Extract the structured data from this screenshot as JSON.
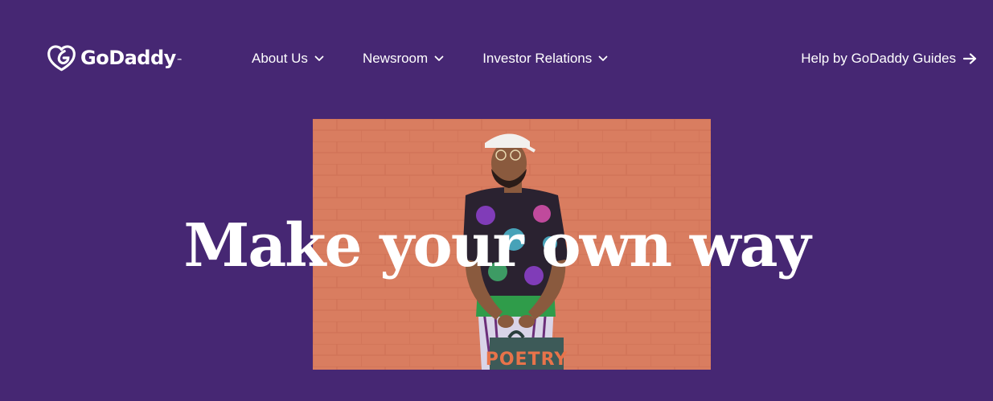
{
  "brand": {
    "name": "GoDaddy",
    "trademark": "™",
    "logo_icon": "godaddy-heart-icon"
  },
  "nav": {
    "items": [
      {
        "label": "About Us",
        "icon": "chevron-down-icon"
      },
      {
        "label": "Newsroom",
        "icon": "chevron-down-icon"
      },
      {
        "label": "Investor Relations",
        "icon": "chevron-down-icon"
      }
    ],
    "help": {
      "label": "Help by GoDaddy Guides",
      "icon": "arrow-right-icon"
    }
  },
  "hero": {
    "title": "Make your own way",
    "image_sign_text": "POETRY"
  },
  "colors": {
    "background": "#462773",
    "text": "#ffffff",
    "brick": "#d97a5e"
  }
}
